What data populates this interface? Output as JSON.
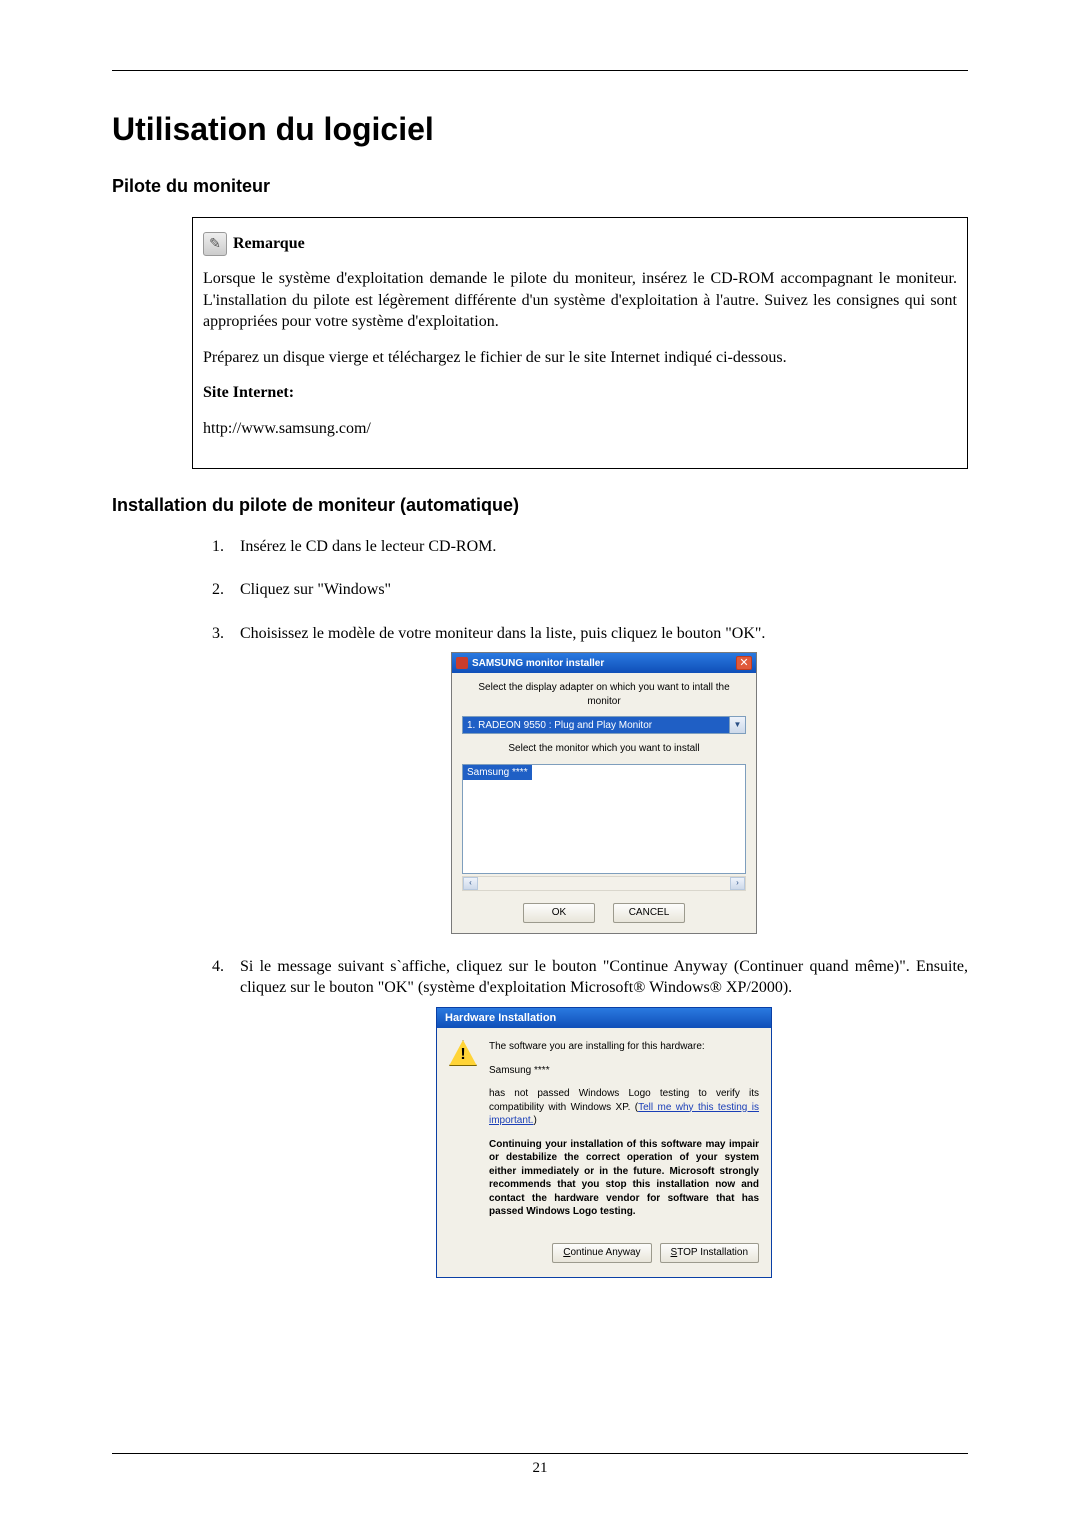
{
  "heading": "Utilisation du logiciel",
  "sub1": "Pilote du moniteur",
  "note": {
    "title": "Remarque",
    "p1": "Lorsque le système d'exploitation demande le pilote du moniteur, insérez le CD-ROM accompagnant le moniteur. L'installation du pilote est légèrement différente d'un système d'exploitation à l'autre. Suivez les consignes qui sont appropriées pour votre système d'exploitation.",
    "p2": "Préparez un disque vierge et téléchargez le fichier de sur le site Internet indiqué ci-dessous.",
    "label": "Site Internet:",
    "url": "http://www.samsung.com/"
  },
  "sub2": "Installation du pilote de moniteur (automatique)",
  "steps": {
    "s1": "Insérez le CD dans le lecteur CD-ROM.",
    "s2": "Cliquez sur \"Windows\"",
    "s3": "Choisissez le modèle de votre moniteur dans la liste, puis cliquez le bouton \"OK\".",
    "s4": "Si le message suivant s`affiche, cliquez sur le bouton \"Continue Anyway (Continuer quand même)\". Ensuite, cliquez sur le bouton \"OK\" (système d'exploitation Microsoft® Windows® XP/2000)."
  },
  "installer": {
    "title": "SAMSUNG monitor installer",
    "instr1": "Select the display adapter on which you want to intall the monitor",
    "dropdown": "1. RADEON 9550 : Plug and Play Monitor",
    "instr2": "Select the monitor which you want to install",
    "listItem": "Samsung ****",
    "ok": "OK",
    "cancel": "CANCEL"
  },
  "hw": {
    "title": "Hardware Installation",
    "line1": "The software you are installing for this hardware:",
    "line2": "Samsung ****",
    "line3a": "has not passed Windows Logo testing to verify its compatibility with Windows XP. (",
    "link": "Tell me why this testing is important.",
    "line3b": ")",
    "bold": "Continuing your installation of this software may impair or destabilize the correct operation of your system either immediately or in the future. Microsoft strongly recommends that you stop this installation now and contact the hardware vendor for software that has passed Windows Logo testing.",
    "btnContinue": "ontinue Anyway",
    "btnContinuePrefix": "C",
    "btnStop": "TOP Installation",
    "btnStopPrefix": "S"
  },
  "pageNumber": "21"
}
